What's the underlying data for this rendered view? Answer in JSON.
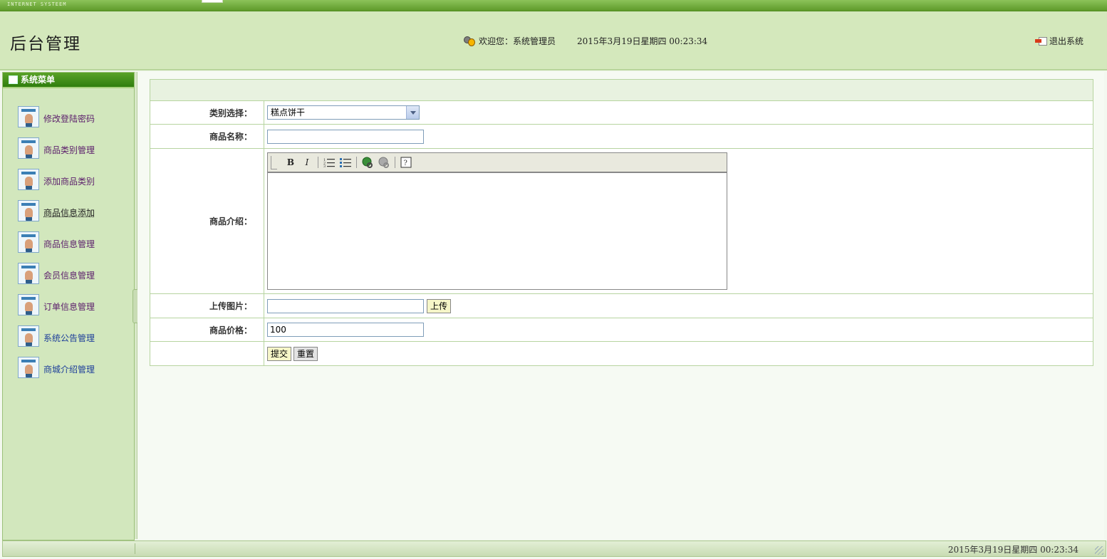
{
  "topstrip": {
    "tag": "INTERNET SYSTEEM"
  },
  "header": {
    "title": "后台管理",
    "welcome": "欢迎您：系统管理员",
    "datetime": "2015年3月19日星期四  00:23:34",
    "logout": "退出系统"
  },
  "sidebar": {
    "title": "系统菜单",
    "items": [
      {
        "label": "修改登陆密码"
      },
      {
        "label": "商品类别管理"
      },
      {
        "label": "添加商品类别"
      },
      {
        "label": "商品信息添加"
      },
      {
        "label": "商品信息管理"
      },
      {
        "label": "会员信息管理"
      },
      {
        "label": "订单信息管理"
      },
      {
        "label": "系统公告管理"
      },
      {
        "label": "商城介绍管理"
      }
    ]
  },
  "form": {
    "category_label": "类别选择：",
    "category_value": "糕点饼干",
    "name_label": "商品名称：",
    "name_value": "",
    "intro_label": "商品介绍：",
    "upload_label": "上传图片：",
    "upload_value": "",
    "upload_button": "上传",
    "price_label": "商品价格：",
    "price_value": "100",
    "submit_button": "提交",
    "reset_button": "重置",
    "editor_toolbar": [
      "B",
      "I"
    ]
  },
  "statusbar": {
    "datetime": "2015年3月19日星期四  00:23:34"
  },
  "colors": {
    "accent_green": "#5e9a2a",
    "header_bg": "#d4e8bc",
    "sidebar_bg": "#d2e7bd"
  }
}
